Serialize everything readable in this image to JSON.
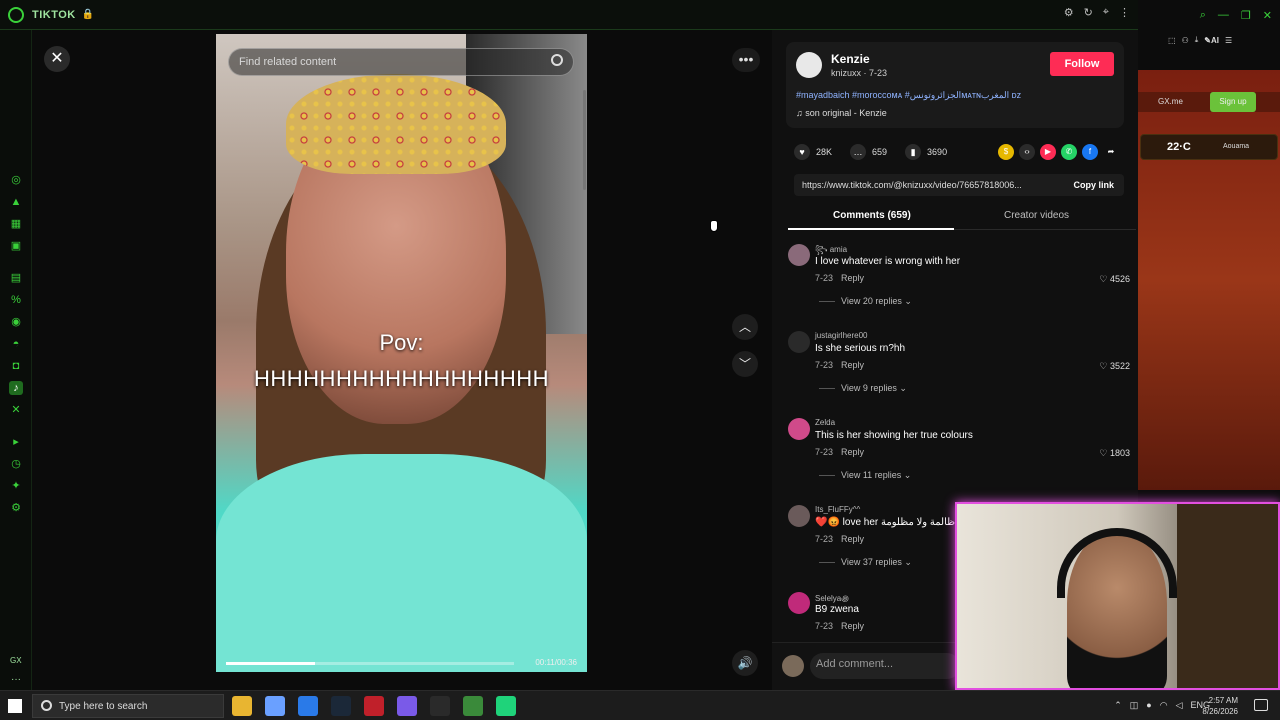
{
  "app": {
    "title": "TIKTOK"
  },
  "video": {
    "search_placeholder": "Find related content",
    "caption_line1": "Pov:",
    "caption_line2": "HHHHHHHHHHHHHHHHHH",
    "time": "00:11/00:36",
    "progress": 0.31
  },
  "author": {
    "name": "Kenzie",
    "handle_date": "knizuxx · 7-23",
    "follow_label": "Follow",
    "hashtags": "#mayadbaich #moroccoᴍᴀ #الجزائروتونسᴍᴀᴛɴالمغرب ᴅᴢ",
    "music": "son original - Kenzie"
  },
  "stats": {
    "likes": "28K",
    "comments": "659",
    "saves": "3690"
  },
  "share": {
    "url": "https://www.tiktok.com/@knizuxx/video/76657818006...",
    "copy_label": "Copy link"
  },
  "tabs": {
    "comments": "Comments (659)",
    "creator_videos": "Creator videos"
  },
  "comments": [
    {
      "user": "꧂ amia",
      "text": "I love whatever is wrong with her",
      "date": "7-23",
      "reply": "Reply",
      "likes": "4526",
      "view_replies": "View 20 replies"
    },
    {
      "user": "justagirlhere00",
      "text": "Is she serious rn?hh",
      "date": "7-23",
      "reply": "Reply",
      "likes": "3522",
      "view_replies": "View 9 replies"
    },
    {
      "user": "Zelda",
      "text": "This is her showing her true colours",
      "date": "7-23",
      "reply": "Reply",
      "likes": "1803",
      "view_replies": "View 11 replies"
    },
    {
      "user": "Its_FluFFy^^",
      "text": "❤️😡 love her ظالمة ولا مظلومة",
      "date": "7-23",
      "reply": "Reply",
      "likes": "",
      "view_replies": "View 37 replies"
    },
    {
      "user": "Selelya꩜",
      "text": "B9 zwena",
      "date": "7-23",
      "reply": "Reply",
      "likes": "",
      "view_replies": ""
    }
  ],
  "add_comment": {
    "placeholder": "Add comment..."
  },
  "opera": {
    "gxme": "GX.me",
    "signup": "Sign up",
    "temp": "22·C",
    "city": "Aouama"
  },
  "taskbar": {
    "search_placeholder": "Type here to search",
    "lang": "ENG",
    "time": "2:57 AM",
    "date": "8/26/2026"
  },
  "colors": {
    "accent": "#3ad13a",
    "follow": "#fe2c55",
    "cam_border": "#e24fe0"
  }
}
